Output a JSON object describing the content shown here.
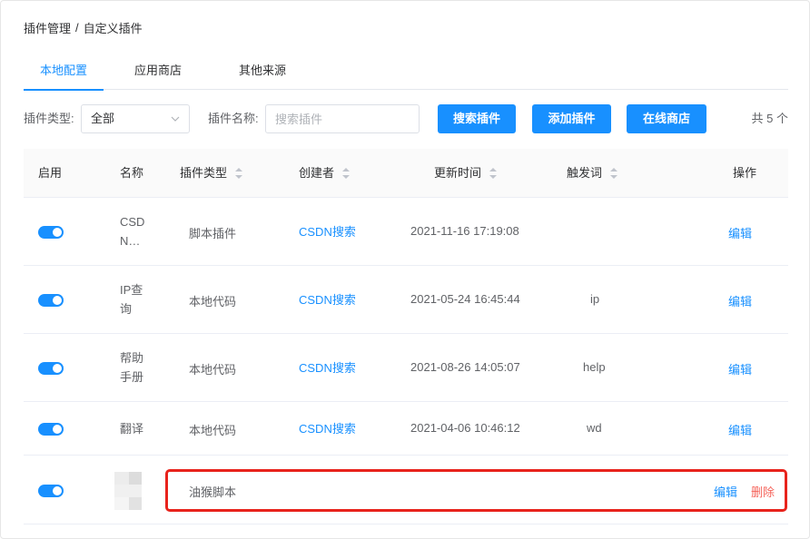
{
  "breadcrumb": {
    "parent": "插件管理",
    "separator": "/",
    "current": "自定义插件"
  },
  "tabs": [
    {
      "label": "本地配置",
      "active": true
    },
    {
      "label": "应用商店",
      "active": false
    },
    {
      "label": "其他来源",
      "active": false
    }
  ],
  "filters": {
    "type_label": "插件类型:",
    "type_value": "全部",
    "name_label": "插件名称:",
    "name_placeholder": "搜索插件",
    "search_button": "搜索插件",
    "add_button": "添加插件",
    "store_button": "在线商店",
    "total": "共 5 个"
  },
  "table": {
    "columns": [
      "启用",
      "名称",
      "插件类型",
      "创建者",
      "更新时间",
      "触发词",
      "操作"
    ],
    "rows": [
      {
        "enabled": true,
        "name": "CSDN…",
        "type": "脚本插件",
        "creator": "CSDN搜索",
        "updated": "2021-11-16 17:19:08",
        "trigger": "",
        "actions": [
          "编辑"
        ]
      },
      {
        "enabled": true,
        "name": "IP查询",
        "type": "本地代码",
        "creator": "CSDN搜索",
        "updated": "2021-05-24 16:45:44",
        "trigger": "ip",
        "actions": [
          "编辑"
        ]
      },
      {
        "enabled": true,
        "name": "帮助手册",
        "type": "本地代码",
        "creator": "CSDN搜索",
        "updated": "2021-08-26 14:05:07",
        "trigger": "help",
        "actions": [
          "编辑"
        ]
      },
      {
        "enabled": true,
        "name": "翻译",
        "type": "本地代码",
        "creator": "CSDN搜索",
        "updated": "2021-04-06 10:46:12",
        "trigger": "wd",
        "actions": [
          "编辑"
        ]
      },
      {
        "enabled": true,
        "name": "",
        "type": "油猴脚本",
        "creator": "",
        "updated": "",
        "trigger": "",
        "actions": [
          "编辑",
          "删除"
        ]
      }
    ]
  },
  "colors": {
    "primary": "#1890ff",
    "danger": "#f5635a",
    "highlight": "#e8231c"
  }
}
